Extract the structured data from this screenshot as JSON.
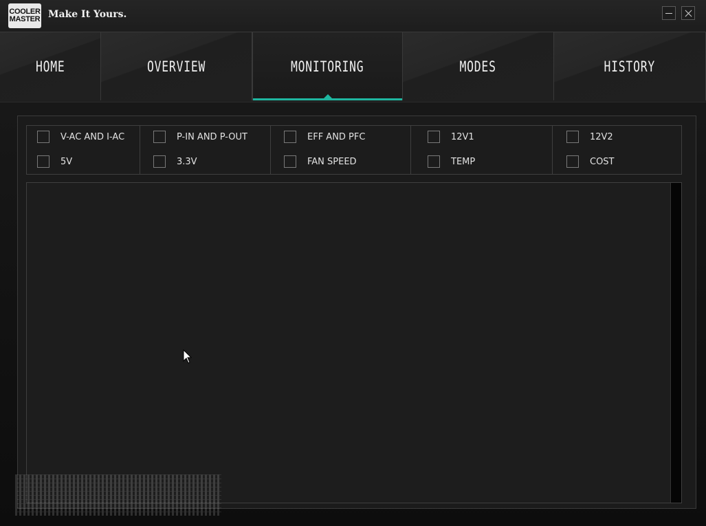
{
  "titlebar": {
    "logo_line1": "COOLER",
    "logo_line2": "MASTER",
    "slogan": "Make It Yours.",
    "minimize_icon": "minimize-icon",
    "close_icon": "close-icon"
  },
  "tabs": [
    {
      "label": "HOME",
      "active": false
    },
    {
      "label": "OVERVIEW",
      "active": false
    },
    {
      "label": "MONITORING",
      "active": true
    },
    {
      "label": "MODES",
      "active": false
    },
    {
      "label": "HISTORY",
      "active": false
    }
  ],
  "accent_color": "#1fb6a0",
  "monitoring": {
    "options": [
      {
        "label": "V-AC AND I-AC",
        "checked": false
      },
      {
        "label": "P-IN AND P-OUT",
        "checked": false
      },
      {
        "label": "EFF AND PFC",
        "checked": false
      },
      {
        "label": "12V1",
        "checked": false
      },
      {
        "label": "12V2",
        "checked": false
      },
      {
        "label": "5V",
        "checked": false
      },
      {
        "label": "3.3V",
        "checked": false
      },
      {
        "label": "FAN SPEED",
        "checked": false
      },
      {
        "label": "TEMP",
        "checked": false
      },
      {
        "label": "COST",
        "checked": false
      }
    ]
  }
}
